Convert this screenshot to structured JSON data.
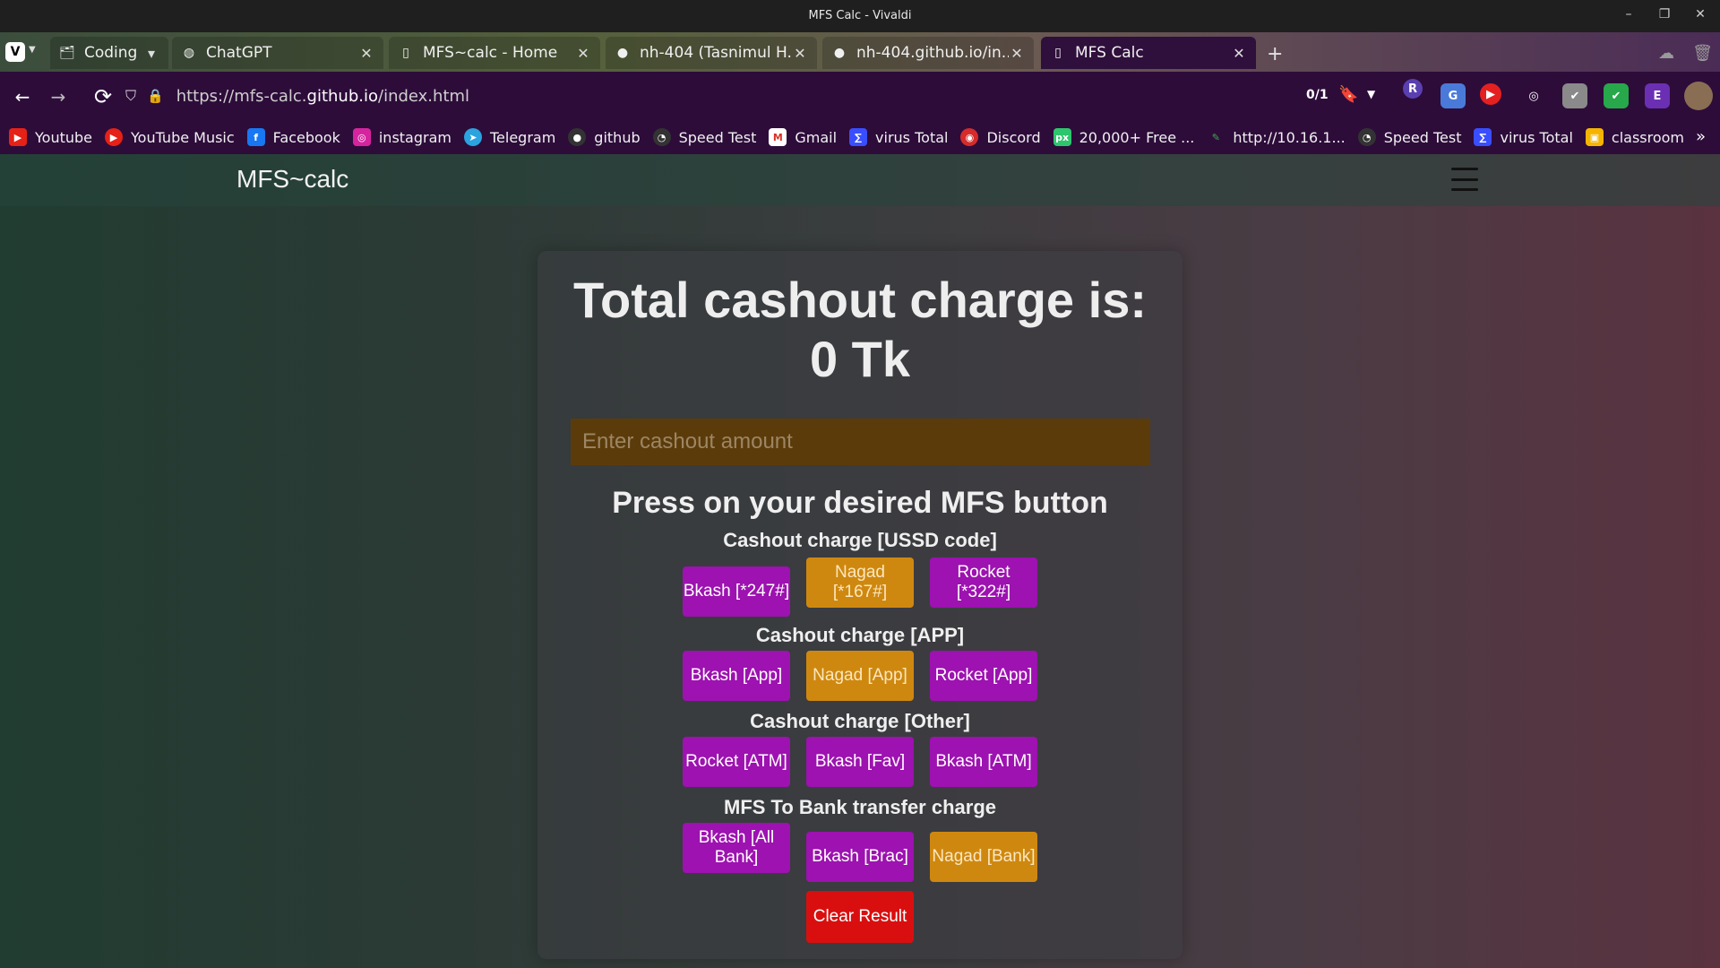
{
  "window": {
    "title": "MFS Calc - Vivaldi"
  },
  "tabs": [
    {
      "label": "Coding",
      "icon": "tab-stack-icon"
    },
    {
      "label": "ChatGPT",
      "icon": "chatgpt-icon"
    },
    {
      "label": "MFS~calc - Home",
      "icon": "page-icon"
    },
    {
      "label": "nh-404 (Tasnimul H...",
      "icon": "github-icon"
    },
    {
      "label": "nh-404.github.io/in...",
      "icon": "github-icon"
    },
    {
      "label": "MFS Calc",
      "icon": "page-icon",
      "active": true
    }
  ],
  "address": {
    "scheme": "https://",
    "host_prefix": "mfs-calc.",
    "host": "github.io",
    "path": "/index.html",
    "counter": "0/1"
  },
  "extensions": [
    "R",
    "G",
    "▶",
    "◎",
    "✔",
    "✔",
    "E"
  ],
  "bookmarks": [
    {
      "label": "Youtube",
      "icon": "youtube-icon",
      "color": "#e62117"
    },
    {
      "label": "YouTube Music",
      "icon": "youtube-music-icon",
      "color": "#e62117"
    },
    {
      "label": "Facebook",
      "icon": "facebook-icon",
      "color": "#1877f2"
    },
    {
      "label": "instagram",
      "icon": "instagram-icon",
      "color": "#d6249f"
    },
    {
      "label": "Telegram",
      "icon": "telegram-icon",
      "color": "#2aa3df"
    },
    {
      "label": "github",
      "icon": "github-icon",
      "color": "#333333"
    },
    {
      "label": "Speed Test",
      "icon": "speedtest-icon",
      "color": "#333333"
    },
    {
      "label": "Gmail",
      "icon": "gmail-icon",
      "color": "#d93025"
    },
    {
      "label": "virus Total",
      "icon": "virustotal-icon",
      "color": "#394eff"
    },
    {
      "label": "Discord",
      "icon": "discord-icon",
      "color": "#d52b2b"
    },
    {
      "label": "20,000+ Free ...",
      "icon": "pixabay-icon",
      "color": "#2ec66d"
    },
    {
      "label": "http://10.16.1...",
      "icon": "feather-icon",
      "color": "#2d7d32"
    },
    {
      "label": "Speed Test",
      "icon": "speedtest-icon",
      "color": "#333333"
    },
    {
      "label": "virus Total",
      "icon": "virustotal-icon",
      "color": "#394eff"
    },
    {
      "label": "classroom",
      "icon": "classroom-icon",
      "color": "#f4b400"
    }
  ],
  "site": {
    "brand": "MFS~calc",
    "result_line1": "Total cashout charge is:",
    "result_line2": "0 Tk",
    "input_placeholder": "Enter cashout amount",
    "prompt": "Press on your desired MFS button",
    "sections": {
      "ussd": "Cashout charge [USSD code]",
      "app": "Cashout charge [APP]",
      "other": "Cashout charge [Other]",
      "bank": "MFS To Bank transfer charge"
    },
    "buttons": {
      "ussd": [
        "Bkash [*247#]",
        "Nagad [*167#]",
        "Rocket [*322#]"
      ],
      "app": [
        "Bkash [App]",
        "Nagad [App]",
        "Rocket [App]"
      ],
      "other": [
        "Rocket [ATM]",
        "Bkash [Fav]",
        "Bkash [ATM]"
      ],
      "bank": [
        "Bkash [All Bank]",
        "Bkash [Brac]",
        "Nagad [Bank]"
      ]
    },
    "clear_label": "Clear Result"
  },
  "colors": {
    "bkash": "#9d12b0",
    "nagad": "#cf880f",
    "rocket": "#9d12b0",
    "clear": "#d90f0f"
  }
}
